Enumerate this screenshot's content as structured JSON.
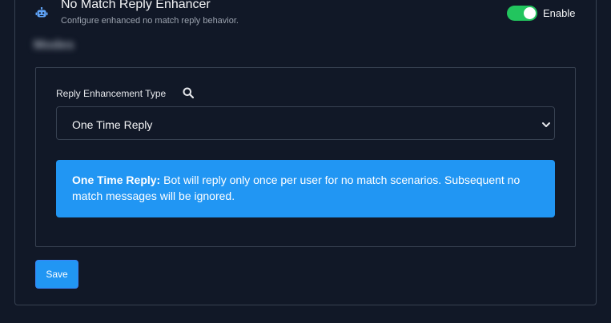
{
  "header": {
    "title": "No Match Reply Enhancer",
    "subtitle": "Configure enhanced no match reply behavior.",
    "icon": "robot-icon"
  },
  "toggle": {
    "label": "Enable",
    "enabled": true
  },
  "blurred_text": "Modes",
  "form": {
    "label": "Reply Enhancement Type",
    "label_icon": "search-icon",
    "selected_value": "One Time Reply",
    "alert_title": "One Time Reply:",
    "alert_text": " Bot will reply only once per user for no match scenarios. Subsequent no match messages will be ignored."
  },
  "save_label": "Save",
  "colors": {
    "background": "#111827",
    "accent": "#2196f3",
    "toggle_on": "#22c55e",
    "icon_blue": "#60a5fa",
    "border": "#374151"
  }
}
